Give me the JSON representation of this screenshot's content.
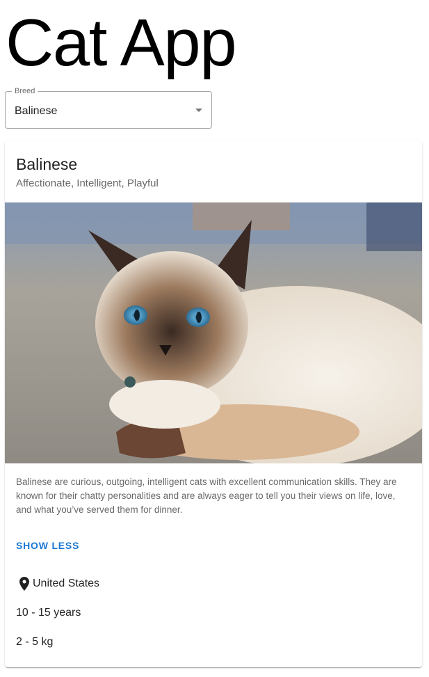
{
  "app": {
    "title": "Cat App"
  },
  "breed_select": {
    "label": "Breed",
    "value": "Balinese",
    "icon": "arrow-drop-down-icon"
  },
  "card": {
    "title": "Balinese",
    "subtitle": "Affectionate, Intelligent, Playful",
    "description": "Balinese are curious, outgoing, intelligent cats with excellent communication skills. They are known for their chatty personalities and are always eager to tell you their views on life, love, and what you’ve served them for dinner.",
    "toggle_label": "SHOW LESS",
    "origin": "United States",
    "origin_icon": "location-pin-icon",
    "life_span": "10 - 15 years",
    "weight": "2 - 5 kg"
  },
  "colors": {
    "accent": "#1976d2",
    "text_primary": "#212121",
    "text_secondary": "#666666"
  }
}
